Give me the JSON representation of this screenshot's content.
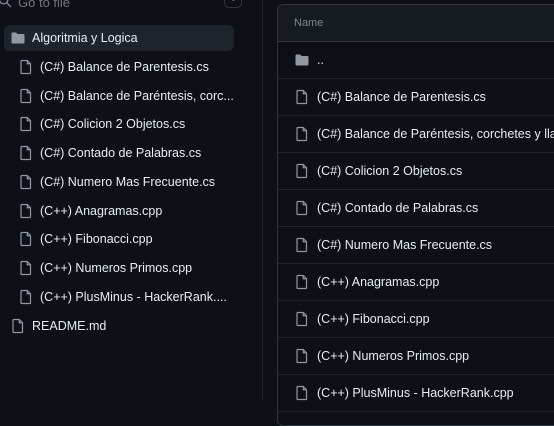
{
  "search": {
    "placeholder": "Go to file",
    "shortcut": "t"
  },
  "tree": {
    "folder": "Algoritmia y Logica",
    "files": [
      "(C#) Balance de Parentesis.cs",
      "(C#) Balance de Paréntesis, corc...",
      "(C#) Colicion 2 Objetos.cs",
      "(C#) Contado de Palabras.cs",
      "(C#) Numero Mas Frecuente.cs",
      "(C++) Anagramas.cpp",
      "(C++) Fibonacci.cpp",
      "(C++) Numeros Primos.cpp",
      "(C++) PlusMinus - HackerRank...."
    ],
    "root_file": "README.md"
  },
  "listing": {
    "header": "Name",
    "parent": "..",
    "rows": [
      "(C#) Balance de Parentesis.cs",
      "(C#) Balance de Paréntesis, corchetes y llaves.cs",
      "(C#) Colicion 2 Objetos.cs",
      "(C#) Contado de Palabras.cs",
      "(C#) Numero Mas Frecuente.cs",
      "(C++) Anagramas.cpp",
      "(C++) Fibonacci.cpp",
      "(C++) Numeros Primos.cpp",
      "(C++) PlusMinus - HackerRank.cpp"
    ]
  },
  "colors": {
    "background": "#0d1117",
    "selected": "#1e242c",
    "border": "#30363d",
    "text": "#e6edf3",
    "muted": "#7d8590"
  }
}
